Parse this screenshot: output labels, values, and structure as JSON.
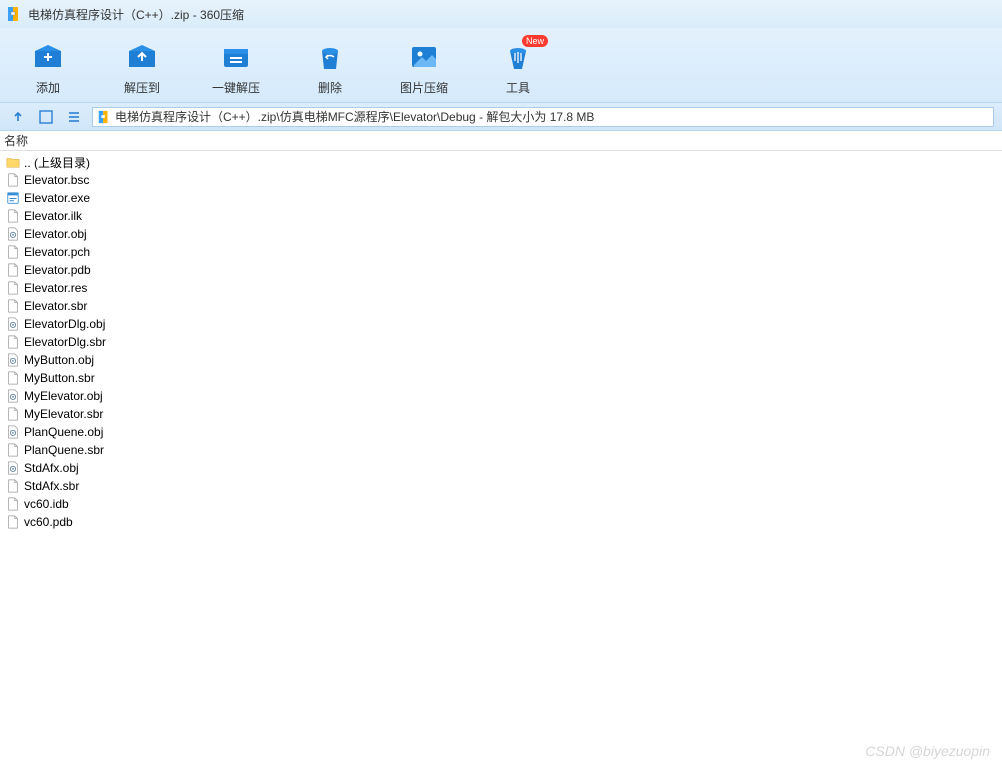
{
  "window": {
    "title": "电梯仿真程序设计（C++）.zip - 360压缩"
  },
  "toolbar": {
    "add": "添加",
    "extract_to": "解压到",
    "one_click": "一键解压",
    "delete": "删除",
    "image_compress": "图片压缩",
    "tools": "工具",
    "new_badge": "New"
  },
  "pathbar": {
    "path": "电梯仿真程序设计（C++）.zip\\仿真电梯MFC源程序\\Elevator\\Debug - 解包大小为 17.8 MB"
  },
  "columns": {
    "name": "名称"
  },
  "files": [
    {
      "name": ".. (上级目录)",
      "icon": "folder-up"
    },
    {
      "name": "Elevator.bsc",
      "icon": "file"
    },
    {
      "name": "Elevator.exe",
      "icon": "exe"
    },
    {
      "name": "Elevator.ilk",
      "icon": "file"
    },
    {
      "name": "Elevator.obj",
      "icon": "obj"
    },
    {
      "name": "Elevator.pch",
      "icon": "file"
    },
    {
      "name": "Elevator.pdb",
      "icon": "file"
    },
    {
      "name": "Elevator.res",
      "icon": "file"
    },
    {
      "name": "Elevator.sbr",
      "icon": "file"
    },
    {
      "name": "ElevatorDlg.obj",
      "icon": "obj"
    },
    {
      "name": "ElevatorDlg.sbr",
      "icon": "file"
    },
    {
      "name": "MyButton.obj",
      "icon": "obj"
    },
    {
      "name": "MyButton.sbr",
      "icon": "file"
    },
    {
      "name": "MyElevator.obj",
      "icon": "obj"
    },
    {
      "name": "MyElevator.sbr",
      "icon": "file"
    },
    {
      "name": "PlanQuene.obj",
      "icon": "obj"
    },
    {
      "name": "PlanQuene.sbr",
      "icon": "file"
    },
    {
      "name": "StdAfx.obj",
      "icon": "obj"
    },
    {
      "name": "StdAfx.sbr",
      "icon": "file"
    },
    {
      "name": "vc60.idb",
      "icon": "file"
    },
    {
      "name": "vc60.pdb",
      "icon": "file"
    }
  ],
  "watermark": "CSDN @biyezuopin"
}
